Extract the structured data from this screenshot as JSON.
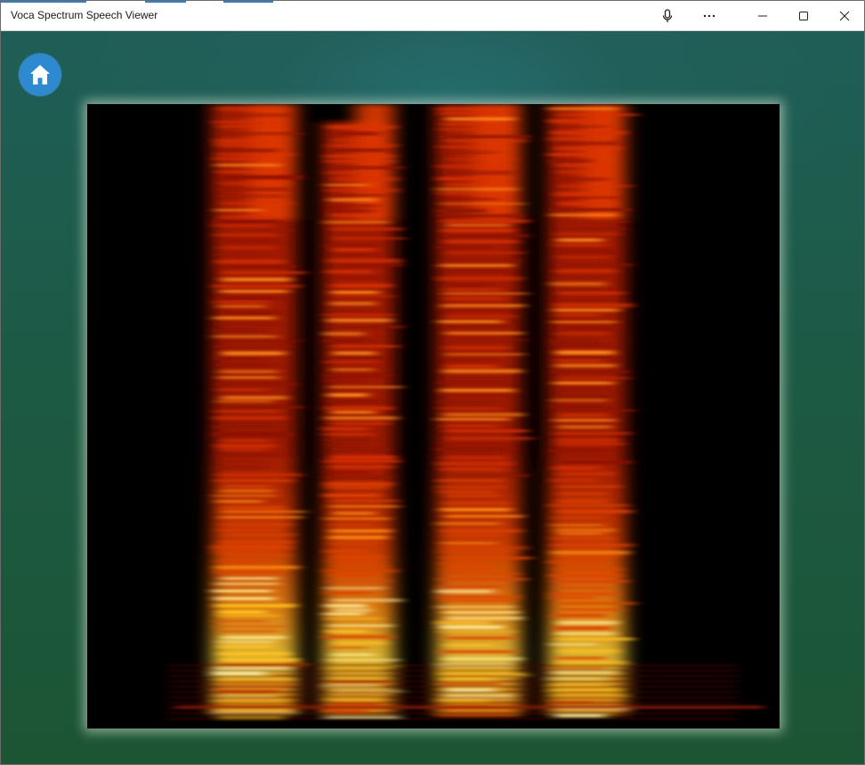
{
  "window": {
    "title": "Voca Spectrum Speech Viewer"
  },
  "titlebar": {
    "icons": [
      "microphone-icon",
      "more-icon",
      "minimize-icon",
      "maximize-icon",
      "close-icon"
    ]
  },
  "home": {
    "icon": "home-icon",
    "color": "#2e8ad0"
  },
  "spectrogram": {
    "colormap": [
      "#000000",
      "#3a0000",
      "#b01500",
      "#ff4a00",
      "#ff9a10",
      "#ffe040",
      "#fff7b0"
    ],
    "syllable_count": 4
  }
}
